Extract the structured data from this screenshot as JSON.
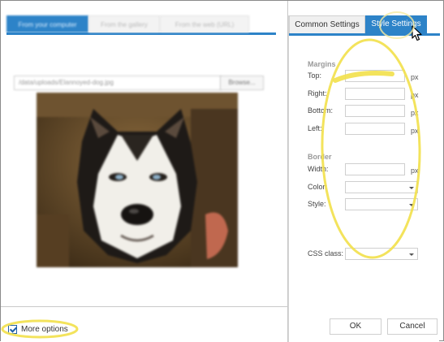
{
  "left_tabs": [
    {
      "label": "From your computer",
      "active": true
    },
    {
      "label": "From the gallery",
      "active": false
    },
    {
      "label": "From the web (URL)",
      "active": false
    }
  ],
  "file": {
    "path": "/data/uploads/Elannoyed-dog.jpg",
    "browse_label": "Browse..."
  },
  "more_options": {
    "label": "More options",
    "checked": true
  },
  "right_tabs": [
    {
      "label": "Common Settings",
      "active": false
    },
    {
      "label": "Style Settings",
      "active": true
    }
  ],
  "margins": {
    "heading": "Margins",
    "fields": [
      {
        "label": "Top:",
        "value": "",
        "unit": "px"
      },
      {
        "label": "Right:",
        "value": "",
        "unit": "px"
      },
      {
        "label": "Bottom:",
        "value": "",
        "unit": "px"
      },
      {
        "label": "Left:",
        "value": "",
        "unit": "px"
      }
    ]
  },
  "border": {
    "heading": "Border",
    "width": {
      "label": "Width:",
      "value": "",
      "unit": "px"
    },
    "color": {
      "label": "Color:",
      "value": ""
    },
    "style": {
      "label": "Style:",
      "value": ""
    }
  },
  "css_class": {
    "label": "CSS class:",
    "value": ""
  },
  "buttons": {
    "ok": "OK",
    "cancel": "Cancel"
  },
  "colors": {
    "accent_blue": "#2d83c8",
    "highlight_yellow": "#f2e04a"
  },
  "icons": [
    "mouse-pointer-icon",
    "checkbox-check-icon",
    "dropdown-arrow-icon"
  ]
}
